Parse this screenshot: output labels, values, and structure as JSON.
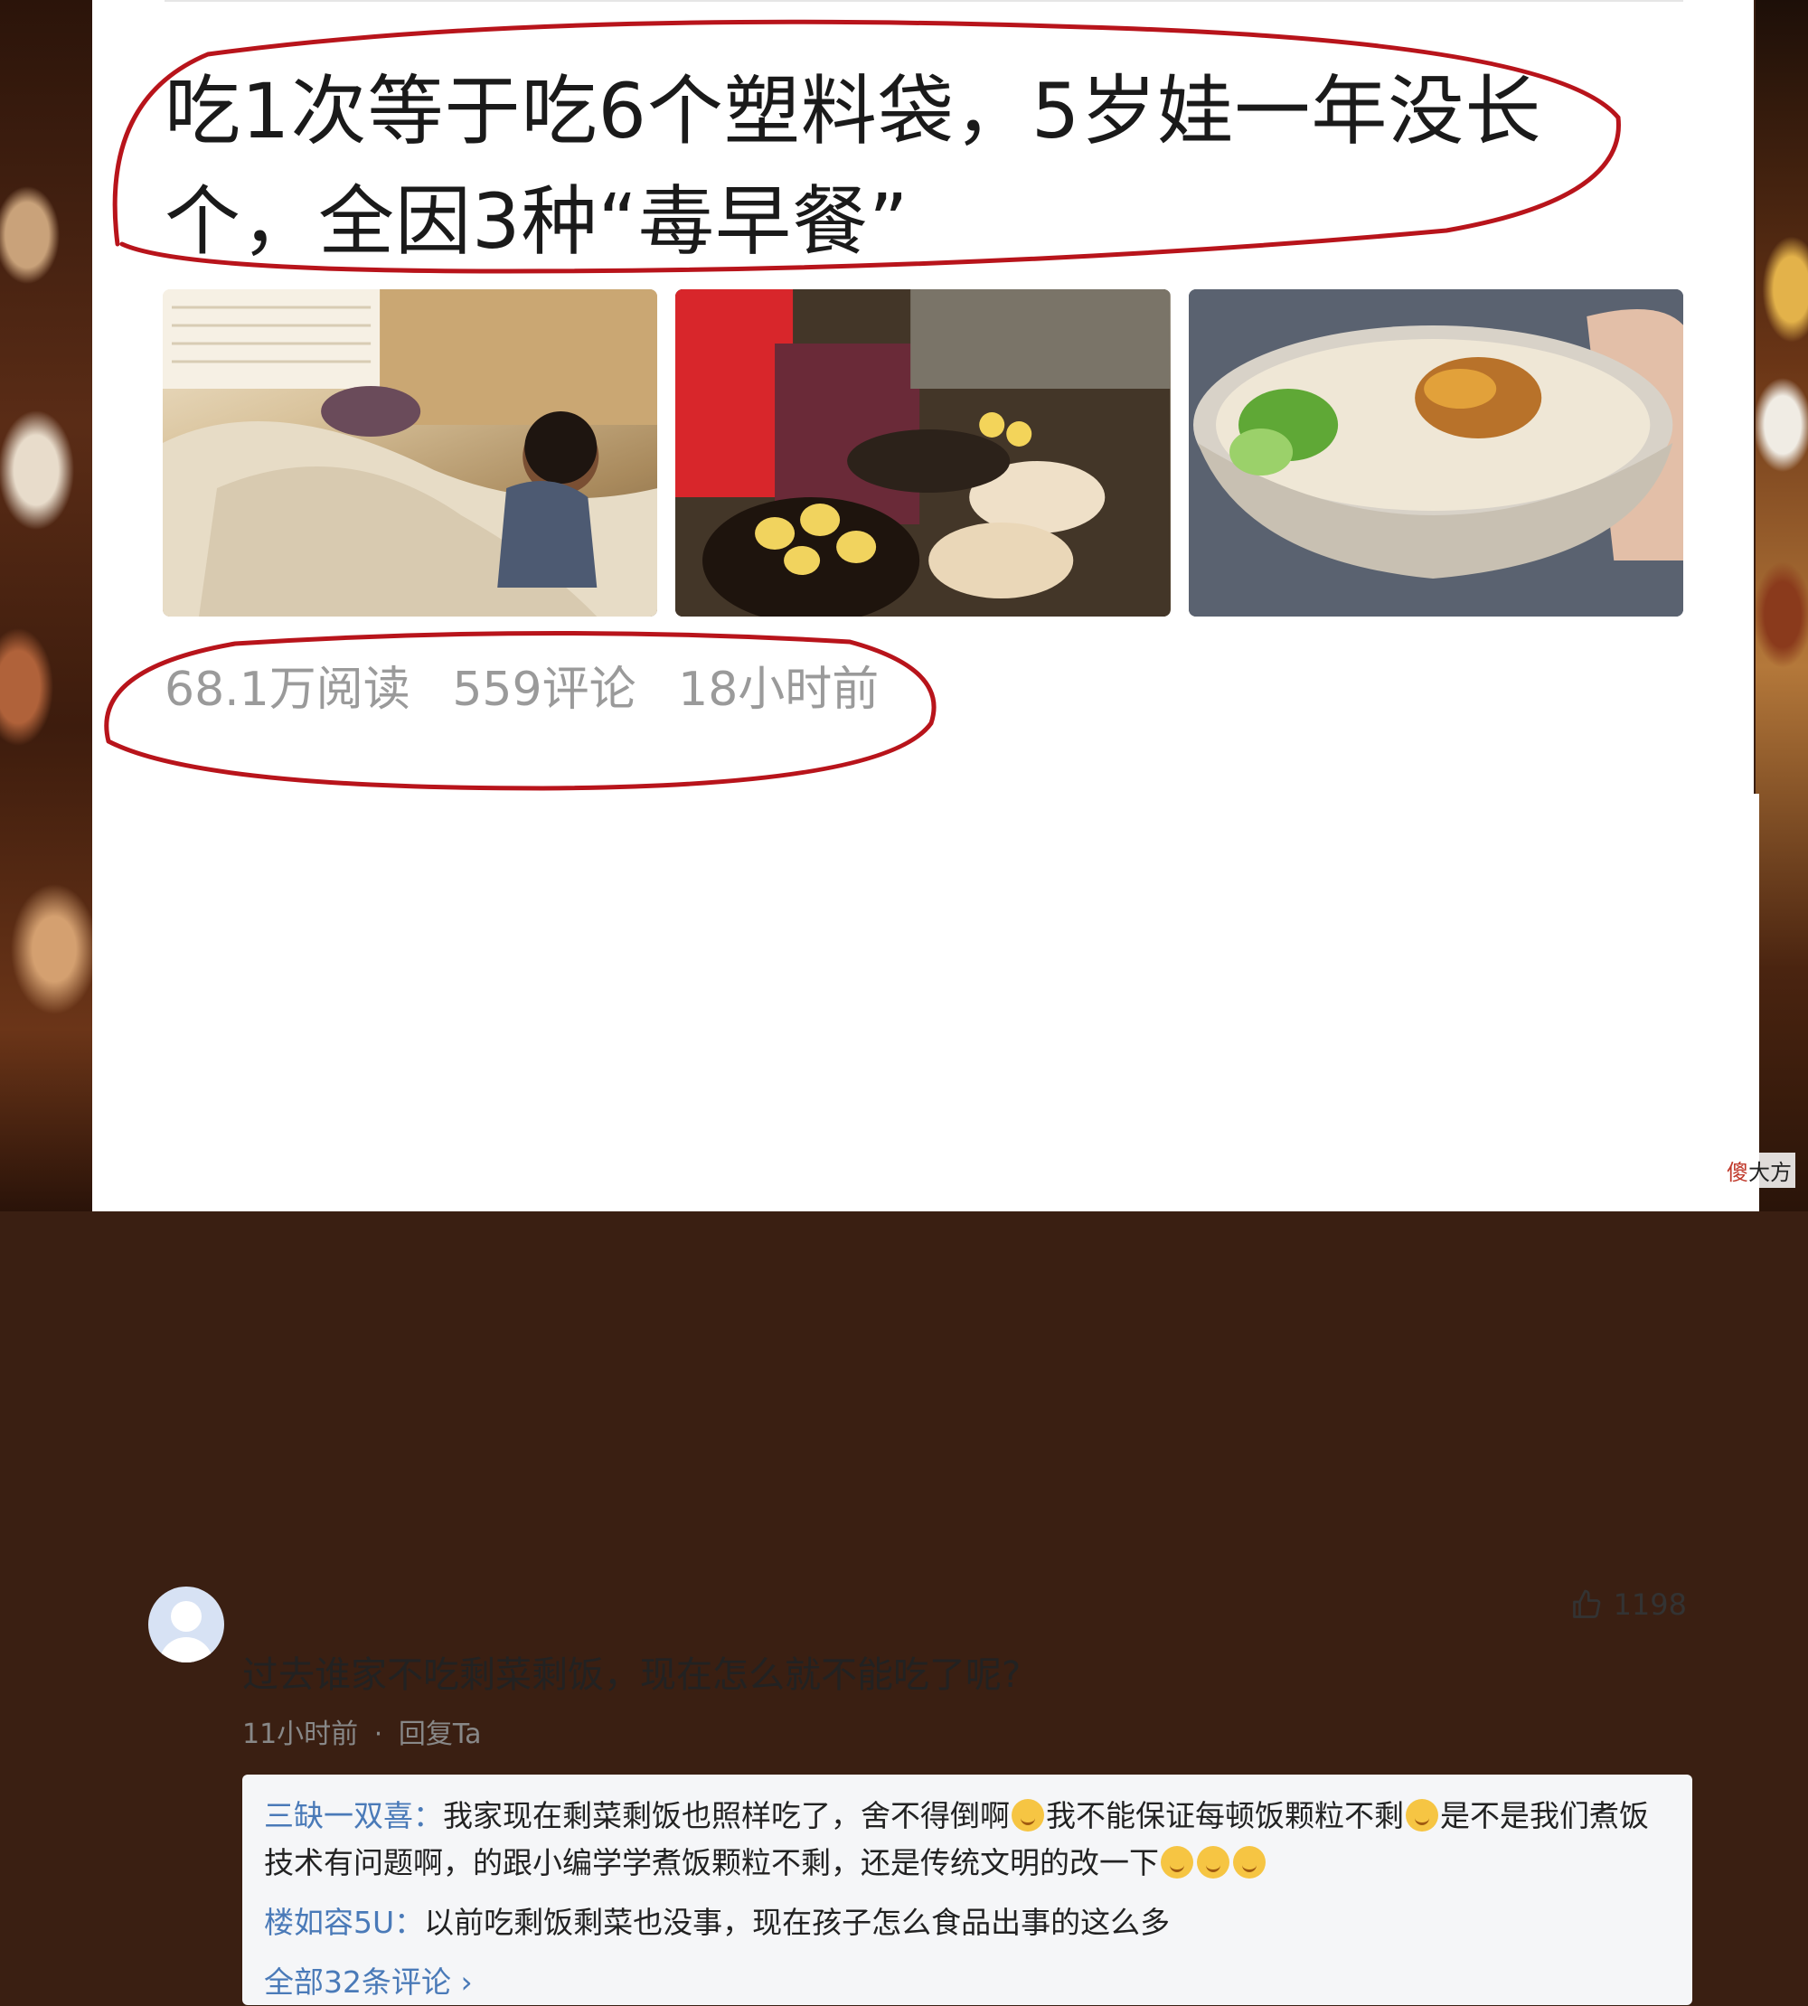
{
  "article": {
    "title_line1": "吃1次等于吃6个塑料袋，5岁娃一年没长",
    "title_line2": "个，全因3种“毒早餐”",
    "reads": "68.1万阅读",
    "comments": "559评论",
    "time": "18小时前"
  },
  "comment": {
    "likes": "1198",
    "text": "过去谁家不吃剩菜剩饭，现在怎么就不能吃了呢?",
    "time": "11小时前",
    "separator": "·",
    "reply_label": "回复Ta"
  },
  "replies": [
    {
      "user": "三缺一双喜：",
      "text_a": "我家现在剩菜剩饭也照样吃了，舍不得倒啊",
      "text_b": "我不能保证每顿饭颗粒不剩",
      "text_c": "是不是我们煮饭技术有问题啊，的跟小编学学煮饭颗粒不剩，还是传统文明的改一下"
    },
    {
      "user": "楼如容5U：",
      "text": "以前吃剩饭剩菜也没事，现在孩子怎么食品出事的这么多"
    }
  ],
  "all_comments_link": "全部32条评论 ›",
  "watermark": {
    "char1": "傻",
    "rest": "大方"
  },
  "colors": {
    "annotation_red": "#b8141b",
    "link_blue": "#4a7ab8",
    "stats_gray": "#9a9a9a"
  },
  "icons": [
    "thumbs-up-icon",
    "avatar-placeholder-icon",
    "chevron-right-icon",
    "emoji-icon"
  ]
}
